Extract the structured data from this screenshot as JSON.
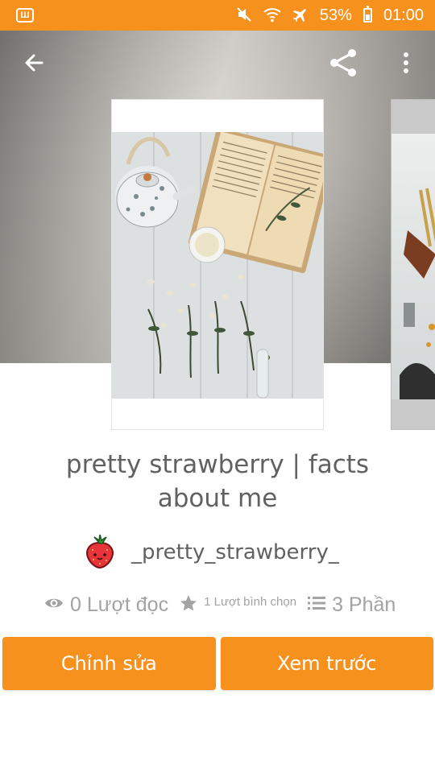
{
  "status_bar": {
    "app_icon_label": "Ш",
    "battery": "53%",
    "battery_level": 0.53,
    "time": "01:00",
    "color": "#f7911d"
  },
  "toolbar": {
    "back_icon": "arrow-left-icon",
    "share_icon": "share-icon",
    "more_icon": "more-vertical-icon"
  },
  "story": {
    "title": "pretty strawberry | facts about me",
    "author": "_pretty_strawberry_",
    "author_avatar": "strawberry-icon",
    "stats": {
      "reads": "0 Lượt đọc",
      "votes": "1 Lượt bình chọn",
      "parts": "3 Phần"
    }
  },
  "actions": {
    "edit_label": "Chỉnh sửa",
    "preview_label": "Xem trước",
    "accent": "#f7911d"
  }
}
